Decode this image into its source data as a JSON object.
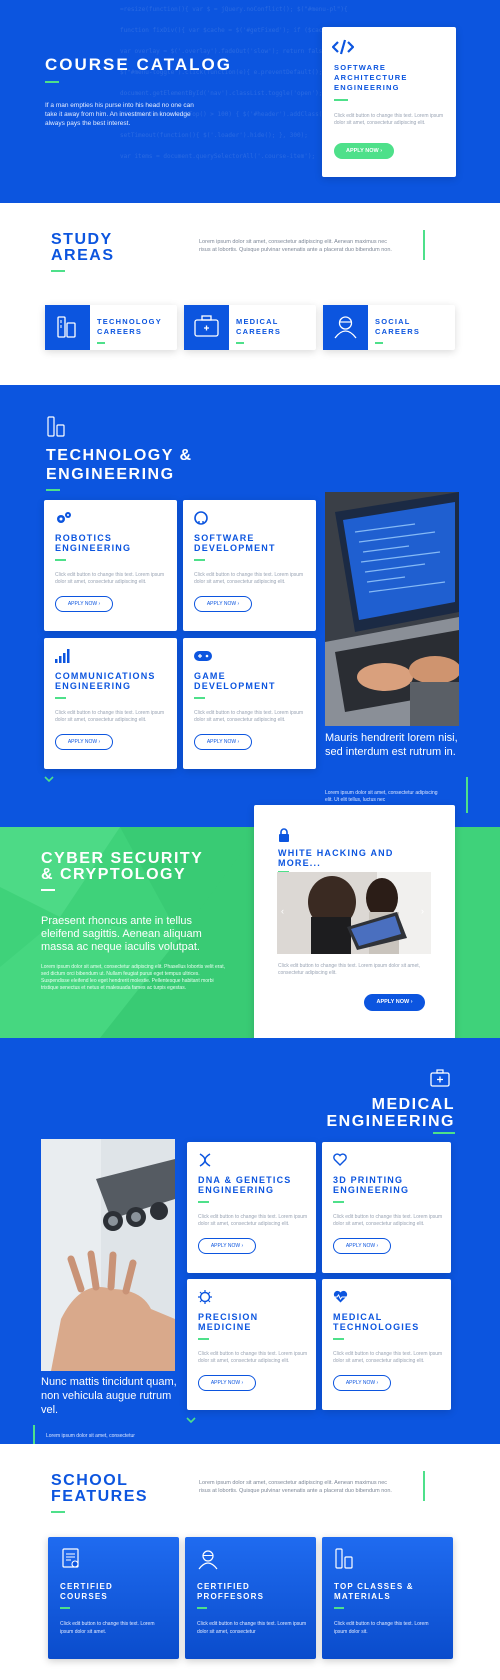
{
  "hero": {
    "title": "COURSE CATALOG",
    "subtitle": "If a man empties his purse into his head no one can take it away from him. An investment in knowledge always pays the best interest.",
    "code_lines": [
      "=resize(function(){ var $ = jQuery.noConflict(); $(\"#menu-pl\"){",
      "function fixDiv(){ var $cache = $('#getFixed'); if ($cache.length)",
      "var overlay = $('.overlay').fadeOut('slow'); return false; });",
      "$(\"#menu-toggle\").click(function(e){ e.preventDefault();",
      "document.getElementById('nav').classList.toggle('open');",
      "if($(window).scrollTop() > 100) { $('#header').addClass('sticky');",
      "setTimeout(function(){ $('.loader').hide(); }, 300);",
      "var items = document.querySelectorAll('.course-item');"
    ],
    "card": {
      "title": "SOFTWARE ARCHITECTURE ENGINEERING",
      "text": "Click edit button to change this text. Lorem ipsum dolor sit amet, consectetur adipiscing elit.",
      "button": "APPLY NOW ›"
    }
  },
  "study": {
    "title_line1": "STUDY",
    "title_line2": "AREAS",
    "text": "Lorem ipsum dolor sit amet, consectetur adipiscing elit. Aenean maximus nec risus at lobortis. Quisque pulvinar venenatis ante a placerat duo bibendum non.",
    "areas": [
      {
        "line1": "TECHNOLOGY",
        "line2": "CAREERS"
      },
      {
        "line1": "MEDICAL",
        "line2": "CAREERS"
      },
      {
        "line1": "SOCIAL",
        "line2": "CAREERS"
      }
    ]
  },
  "tech": {
    "title_line1": "TECHNOLOGY &",
    "title_line2": "ENGINEERING",
    "cards": [
      {
        "title": "ROBOTICS ENGINEERING",
        "text": "Click edit button to change this text. Lorem ipsum dolor sit amet, consectetur adipiscing elit.",
        "button": "APPLY NOW ›"
      },
      {
        "title": "SOFTWARE DEVELOPMENT",
        "text": "Click edit button to change this text. Lorem ipsum dolor sit amet, consectetur adipiscing elit.",
        "button": "APPLY NOW ›"
      },
      {
        "title": "COMMUNICATIONS ENGINEERING",
        "text": "Click edit button to change this text. Lorem ipsum dolor sit amet, consectetur adipiscing elit.",
        "button": "APPLY NOW ›"
      },
      {
        "title": "GAME DEVELOPMENT",
        "text": "Click edit button to change this text. Lorem ipsum dolor sit amet, consectetur adipiscing elit.",
        "button": "APPLY NOW ›"
      }
    ],
    "caption": "Mauris hendrerit lorem nisi, sed interdum est rutrum in.",
    "caption_small": "Lorem ipsum dolor sit amet, consectetur adipiscing elit. Ut elit tellus, luctus nec"
  },
  "cyber": {
    "title_line1": "CYBER SECURITY",
    "title_line2": "& CRYPTOLOGY",
    "lead": "Praesent rhoncus ante in tellus eleifend sagittis. Aenean aliquam massa ac neque iaculis volutpat.",
    "body": "Lorem ipsum dolor sit amet, consectetur adipiscing elit. Phasellus lobortis velit erat, sed dictum orci bibendum ut. Nullam feugiat purus eget tempus ultrices. Suspendisse eleifend leo eget hendrerit molestie. Pellentesque habitant morbi tristique senectus et netus et malesuada fames ac turpis egestas.",
    "card": {
      "title": "WHITE HACKING AND MORE...",
      "text": "Click edit button to change this text. Lorem ipsum dolor sit amet, consectetur adipiscing elit.",
      "button": "APPLY NOW ›"
    }
  },
  "medical": {
    "title_line1": "MEDICAL",
    "title_line2": "ENGINEERING",
    "cards": [
      {
        "title": "DNA & GENETICS ENGINEERING",
        "text": "Click edit button to change this text. Lorem ipsum dolor sit amet, consectetur adipiscing elit.",
        "button": "APPLY NOW ›"
      },
      {
        "title": "3D PRINTING ENGINEERING",
        "text": "Click edit button to change this text. Lorem ipsum dolor sit amet, consectetur adipiscing elit.",
        "button": "APPLY NOW ›"
      },
      {
        "title": "PRECISION MEDICINE",
        "text": "Click edit button to change this text. Lorem ipsum dolor sit amet, consectetur adipiscing elit.",
        "button": "APPLY NOW ›"
      },
      {
        "title": "MEDICAL TECHNOLOGIES",
        "text": "Click edit button to change this text. Lorem ipsum dolor sit amet, consectetur adipiscing elit.",
        "button": "APPLY NOW ›"
      }
    ],
    "caption": "Nunc mattis tincidunt quam, non vehicula augue rutrum vel.",
    "caption_small": "Lorem ipsum dolor sit amet, consectetur"
  },
  "features": {
    "title_line1": "SCHOOL",
    "title_line2": "FEATURES",
    "text": "Lorem ipsum dolor sit amet, consectetur adipiscing elit. Aenean maximus nec risus at lobortis. Quisque pulvinar venenatis ante a placerat duo bibendum non.",
    "cards": [
      {
        "line1": "CERTIFIED",
        "line2": "COURSES",
        "text": "Click edit button to change this text. Lorem ipsum dolor sit amet."
      },
      {
        "line1": "CERTIFIED",
        "line2": "PROFFESORS",
        "text": "Click edit button to change this text. Lorem ipsum dolor sit amet, consectetur"
      },
      {
        "line1": "TOP CLASSES &",
        "line2": "MATERIALS",
        "text": "Click edit button to change this text. Lorem ipsum dolor sit."
      }
    ]
  },
  "colors": {
    "primary": "#0c55df",
    "accent": "#4ee08a",
    "white": "#ffffff"
  }
}
